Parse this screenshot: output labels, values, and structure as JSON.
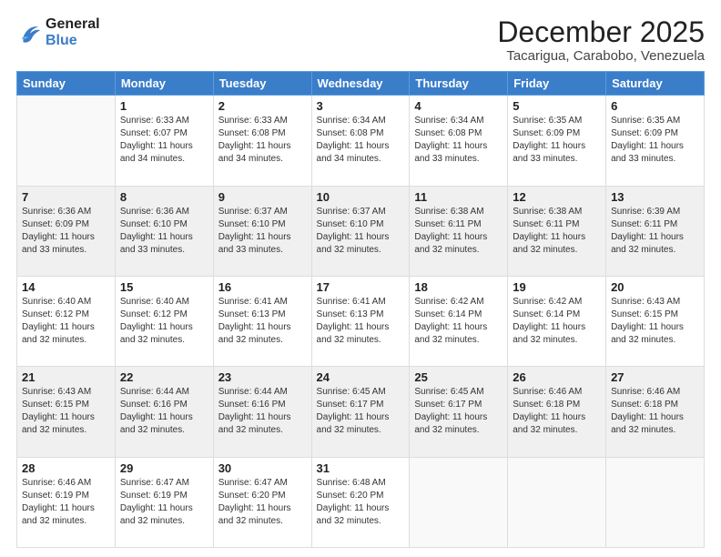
{
  "header": {
    "logo_line1": "General",
    "logo_line2": "Blue",
    "month": "December 2025",
    "location": "Tacarigua, Carabobo, Venezuela"
  },
  "days_of_week": [
    "Sunday",
    "Monday",
    "Tuesday",
    "Wednesday",
    "Thursday",
    "Friday",
    "Saturday"
  ],
  "weeks": [
    [
      {
        "day": "",
        "empty": true
      },
      {
        "day": "1",
        "sunrise": "Sunrise: 6:33 AM",
        "sunset": "Sunset: 6:07 PM",
        "daylight": "Daylight: 11 hours and 34 minutes."
      },
      {
        "day": "2",
        "sunrise": "Sunrise: 6:33 AM",
        "sunset": "Sunset: 6:08 PM",
        "daylight": "Daylight: 11 hours and 34 minutes."
      },
      {
        "day": "3",
        "sunrise": "Sunrise: 6:34 AM",
        "sunset": "Sunset: 6:08 PM",
        "daylight": "Daylight: 11 hours and 34 minutes."
      },
      {
        "day": "4",
        "sunrise": "Sunrise: 6:34 AM",
        "sunset": "Sunset: 6:08 PM",
        "daylight": "Daylight: 11 hours and 33 minutes."
      },
      {
        "day": "5",
        "sunrise": "Sunrise: 6:35 AM",
        "sunset": "Sunset: 6:09 PM",
        "daylight": "Daylight: 11 hours and 33 minutes."
      },
      {
        "day": "6",
        "sunrise": "Sunrise: 6:35 AM",
        "sunset": "Sunset: 6:09 PM",
        "daylight": "Daylight: 11 hours and 33 minutes."
      }
    ],
    [
      {
        "day": "7",
        "sunrise": "Sunrise: 6:36 AM",
        "sunset": "Sunset: 6:09 PM",
        "daylight": "Daylight: 11 hours and 33 minutes."
      },
      {
        "day": "8",
        "sunrise": "Sunrise: 6:36 AM",
        "sunset": "Sunset: 6:10 PM",
        "daylight": "Daylight: 11 hours and 33 minutes."
      },
      {
        "day": "9",
        "sunrise": "Sunrise: 6:37 AM",
        "sunset": "Sunset: 6:10 PM",
        "daylight": "Daylight: 11 hours and 33 minutes."
      },
      {
        "day": "10",
        "sunrise": "Sunrise: 6:37 AM",
        "sunset": "Sunset: 6:10 PM",
        "daylight": "Daylight: 11 hours and 32 minutes."
      },
      {
        "day": "11",
        "sunrise": "Sunrise: 6:38 AM",
        "sunset": "Sunset: 6:11 PM",
        "daylight": "Daylight: 11 hours and 32 minutes."
      },
      {
        "day": "12",
        "sunrise": "Sunrise: 6:38 AM",
        "sunset": "Sunset: 6:11 PM",
        "daylight": "Daylight: 11 hours and 32 minutes."
      },
      {
        "day": "13",
        "sunrise": "Sunrise: 6:39 AM",
        "sunset": "Sunset: 6:11 PM",
        "daylight": "Daylight: 11 hours and 32 minutes."
      }
    ],
    [
      {
        "day": "14",
        "sunrise": "Sunrise: 6:40 AM",
        "sunset": "Sunset: 6:12 PM",
        "daylight": "Daylight: 11 hours and 32 minutes."
      },
      {
        "day": "15",
        "sunrise": "Sunrise: 6:40 AM",
        "sunset": "Sunset: 6:12 PM",
        "daylight": "Daylight: 11 hours and 32 minutes."
      },
      {
        "day": "16",
        "sunrise": "Sunrise: 6:41 AM",
        "sunset": "Sunset: 6:13 PM",
        "daylight": "Daylight: 11 hours and 32 minutes."
      },
      {
        "day": "17",
        "sunrise": "Sunrise: 6:41 AM",
        "sunset": "Sunset: 6:13 PM",
        "daylight": "Daylight: 11 hours and 32 minutes."
      },
      {
        "day": "18",
        "sunrise": "Sunrise: 6:42 AM",
        "sunset": "Sunset: 6:14 PM",
        "daylight": "Daylight: 11 hours and 32 minutes."
      },
      {
        "day": "19",
        "sunrise": "Sunrise: 6:42 AM",
        "sunset": "Sunset: 6:14 PM",
        "daylight": "Daylight: 11 hours and 32 minutes."
      },
      {
        "day": "20",
        "sunrise": "Sunrise: 6:43 AM",
        "sunset": "Sunset: 6:15 PM",
        "daylight": "Daylight: 11 hours and 32 minutes."
      }
    ],
    [
      {
        "day": "21",
        "sunrise": "Sunrise: 6:43 AM",
        "sunset": "Sunset: 6:15 PM",
        "daylight": "Daylight: 11 hours and 32 minutes."
      },
      {
        "day": "22",
        "sunrise": "Sunrise: 6:44 AM",
        "sunset": "Sunset: 6:16 PM",
        "daylight": "Daylight: 11 hours and 32 minutes."
      },
      {
        "day": "23",
        "sunrise": "Sunrise: 6:44 AM",
        "sunset": "Sunset: 6:16 PM",
        "daylight": "Daylight: 11 hours and 32 minutes."
      },
      {
        "day": "24",
        "sunrise": "Sunrise: 6:45 AM",
        "sunset": "Sunset: 6:17 PM",
        "daylight": "Daylight: 11 hours and 32 minutes."
      },
      {
        "day": "25",
        "sunrise": "Sunrise: 6:45 AM",
        "sunset": "Sunset: 6:17 PM",
        "daylight": "Daylight: 11 hours and 32 minutes."
      },
      {
        "day": "26",
        "sunrise": "Sunrise: 6:46 AM",
        "sunset": "Sunset: 6:18 PM",
        "daylight": "Daylight: 11 hours and 32 minutes."
      },
      {
        "day": "27",
        "sunrise": "Sunrise: 6:46 AM",
        "sunset": "Sunset: 6:18 PM",
        "daylight": "Daylight: 11 hours and 32 minutes."
      }
    ],
    [
      {
        "day": "28",
        "sunrise": "Sunrise: 6:46 AM",
        "sunset": "Sunset: 6:19 PM",
        "daylight": "Daylight: 11 hours and 32 minutes."
      },
      {
        "day": "29",
        "sunrise": "Sunrise: 6:47 AM",
        "sunset": "Sunset: 6:19 PM",
        "daylight": "Daylight: 11 hours and 32 minutes."
      },
      {
        "day": "30",
        "sunrise": "Sunrise: 6:47 AM",
        "sunset": "Sunset: 6:20 PM",
        "daylight": "Daylight: 11 hours and 32 minutes."
      },
      {
        "day": "31",
        "sunrise": "Sunrise: 6:48 AM",
        "sunset": "Sunset: 6:20 PM",
        "daylight": "Daylight: 11 hours and 32 minutes."
      },
      {
        "day": "",
        "empty": true
      },
      {
        "day": "",
        "empty": true
      },
      {
        "day": "",
        "empty": true
      }
    ]
  ]
}
